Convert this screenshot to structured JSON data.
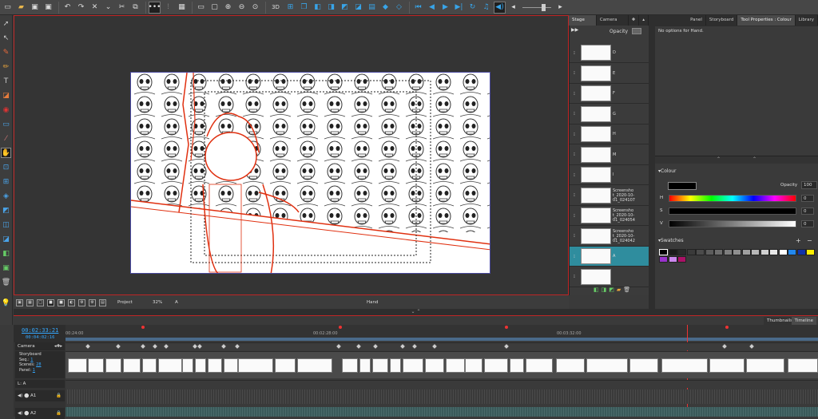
{
  "colors": {
    "accent_red": "#c02626",
    "selected_teal": "#2f8d9e",
    "timecode_blue": "#34a8ff",
    "sketch_red": "#e03010"
  },
  "toolbar": {
    "icons": [
      "folder-open-icon",
      "folder-icon",
      "save-icon",
      "save-all-icon",
      "undo-icon",
      "redo-icon",
      "cut-icon",
      "copy-icon",
      "paste-icon",
      "grid-icon",
      "zoom-in-icon",
      "zoom-out-icon",
      "3d-icon",
      "camera-icon",
      "play-icon"
    ],
    "three_d_label": "3D"
  },
  "stage_tabs": [
    "Stage View",
    "Camera View"
  ],
  "opacity_label": "Opacity",
  "thumbnails": [
    {
      "label": "D",
      "selected": false
    },
    {
      "label": "E",
      "selected": false
    },
    {
      "label": "F",
      "selected": false
    },
    {
      "label": "G",
      "selected": false
    },
    {
      "label": "H",
      "selected": false
    },
    {
      "label": "M",
      "selected": false
    },
    {
      "label": "I",
      "selected": false
    },
    {
      "label": "Screensho t_2020-10- 01_024107",
      "selected": false
    },
    {
      "label": "Screensho t_2020-10- 01_024054",
      "selected": false
    },
    {
      "label": "Screensho t_2020-10- 01_024042",
      "selected": false
    },
    {
      "label": "A",
      "selected": true
    },
    {
      "label": "",
      "selected": false
    }
  ],
  "stagebar": {
    "mode": "Project",
    "zoom": "32%",
    "layer": "A",
    "tool": "Hand"
  },
  "right_tabs": [
    "Panel",
    "Storyboard",
    "Tool Properties : Colour",
    "Library"
  ],
  "tool_props_text": "No options for Hand.",
  "colour": {
    "header": "Colour",
    "opacity_label": "Opacity",
    "opacity_value": "100",
    "h_label": "H",
    "s_label": "S",
    "v_label": "V",
    "h_value": "0",
    "s_value": "0",
    "v_value": "0"
  },
  "swatches": {
    "header": "Swatches",
    "colors": [
      "#000000",
      "#1a1a1a",
      "#2a2a2a",
      "#3a3a3a",
      "#4b4b4b",
      "#5c5c5c",
      "#6d6d6d",
      "#7e7e7e",
      "#8f8f8f",
      "#a0a0a0",
      "#b8b8b8",
      "#d0d0d0",
      "#e8e8e8",
      "#ffffff",
      "#2288ee",
      "#1133aa",
      "#ffee00",
      "#9933cc",
      "#cc88ee",
      "#aa1166"
    ]
  },
  "timeline": {
    "timecode": "00:02:33:21",
    "duration": "00:04:02:16",
    "ruler": [
      "00:02:28:00",
      "00:03:32:00"
    ],
    "ruler_left": "00:24:00",
    "tabs": [
      "Thumbnails",
      "Timeline"
    ],
    "camera_label": "Camera",
    "storyboard": {
      "label": "Storyboard",
      "seq": "1",
      "scene": "28",
      "panel": "1",
      "seq_label": "Seq.:",
      "scene_label": "Scenes:",
      "panel_label": "Panel:"
    },
    "tracks": [
      "L: A",
      "A1",
      "A2"
    ]
  }
}
